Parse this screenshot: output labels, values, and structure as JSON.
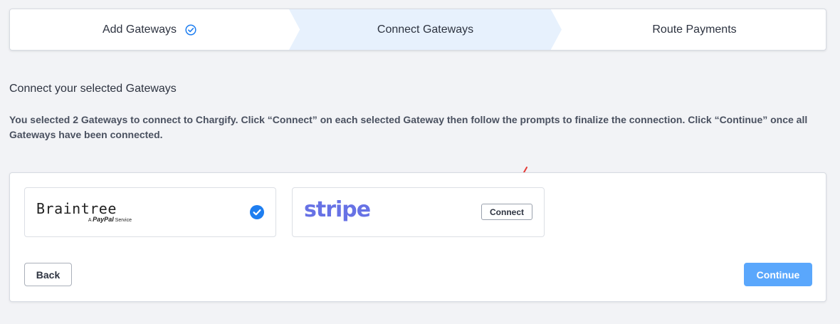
{
  "stepper": {
    "steps": [
      {
        "label": "Add Gateways",
        "state": "complete",
        "icon": "check-circle-outline-icon"
      },
      {
        "label": "Connect Gateways",
        "state": "active"
      },
      {
        "label": "Route Payments",
        "state": "upcoming"
      }
    ],
    "active_color": "#e7f1fd",
    "check_color": "#1e7ef0"
  },
  "section": {
    "title": "Connect your selected Gateways",
    "description": "You selected 2 Gateways to connect to Chargify. Click “Connect” on each selected Gateway then follow the prompts to finalize the connection. Click “Continue” once all Gateways have been connected."
  },
  "gateways": [
    {
      "name": "Braintree",
      "tagline_prefix": "A",
      "tagline_brand": "PayPal",
      "tagline_suffix": "Service",
      "status": "connected",
      "icon": "check-circle-filled-icon"
    },
    {
      "name": "stripe",
      "status": "not-connected",
      "action_label": "Connect",
      "brand_color": "#6772e5"
    }
  ],
  "annotation": {
    "icon": "red-arrow-icon",
    "color": "#e53935"
  },
  "footer": {
    "back_label": "Back",
    "continue_label": "Continue",
    "continue_color": "#5aa7fc"
  }
}
